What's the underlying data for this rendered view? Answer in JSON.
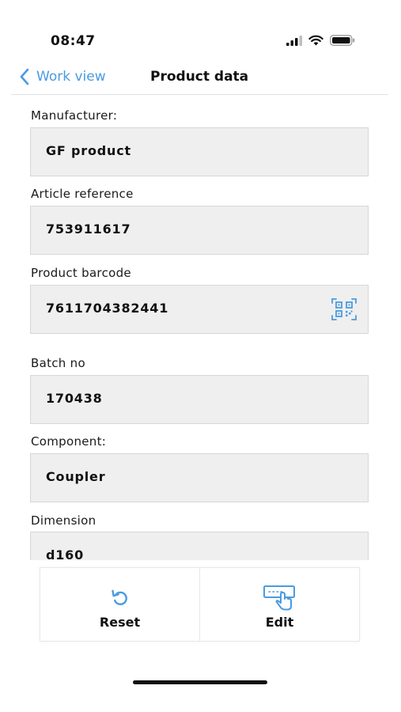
{
  "status_bar": {
    "time": "08:47",
    "icons": [
      "cellular-signal-icon",
      "wifi-icon",
      "battery-icon"
    ]
  },
  "nav": {
    "back_label": "Work view",
    "title": "Product data",
    "accent_color": "#4a9be0"
  },
  "fields": {
    "manufacturer": {
      "label": "Manufacturer:",
      "value": "GF product"
    },
    "article_reference": {
      "label": "Article reference",
      "value": "753911617"
    },
    "product_barcode": {
      "label": "Product barcode",
      "value": "7611704382441",
      "action_icon": "qr-scan-icon"
    },
    "batch_no": {
      "label": "Batch no",
      "value": "170438"
    },
    "component": {
      "label": "Component:",
      "value": "Coupler"
    },
    "dimension": {
      "label": "Dimension",
      "value": "d160"
    }
  },
  "actions": {
    "reset_label": "Reset",
    "reset_icon": "reset-icon",
    "edit_label": "Edit",
    "edit_icon": "edit-touch-icon"
  }
}
